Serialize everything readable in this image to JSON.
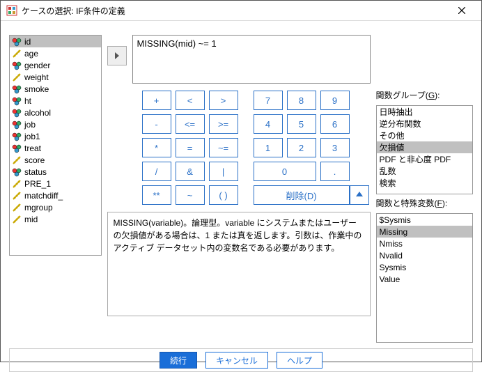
{
  "titlebar": {
    "title": "ケースの選択: IF条件の定義"
  },
  "variables": [
    {
      "name": "id",
      "type": "nominal",
      "selected": true
    },
    {
      "name": "age",
      "type": "scale",
      "selected": false
    },
    {
      "name": "gender",
      "type": "nominal",
      "selected": false
    },
    {
      "name": "weight",
      "type": "scale",
      "selected": false
    },
    {
      "name": "smoke",
      "type": "nominal",
      "selected": false
    },
    {
      "name": "ht",
      "type": "nominal",
      "selected": false
    },
    {
      "name": "alcohol",
      "type": "nominal",
      "selected": false
    },
    {
      "name": "job",
      "type": "nominal",
      "selected": false
    },
    {
      "name": "job1",
      "type": "nominal",
      "selected": false
    },
    {
      "name": "treat",
      "type": "nominal",
      "selected": false
    },
    {
      "name": "score",
      "type": "scale",
      "selected": false
    },
    {
      "name": "status",
      "type": "nominal",
      "selected": false
    },
    {
      "name": "PRE_1",
      "type": "scale",
      "selected": false
    },
    {
      "name": "matchdiff_",
      "type": "scale",
      "selected": false
    },
    {
      "name": "mgroup",
      "type": "scale",
      "selected": false
    },
    {
      "name": "mid",
      "type": "scale",
      "selected": false
    }
  ],
  "expression": "MISSING(mid) ~= 1",
  "keypad": {
    "rows": [
      [
        "+",
        "<",
        ">",
        "7",
        "8",
        "9"
      ],
      [
        "-",
        "<=",
        ">=",
        "4",
        "5",
        "6"
      ],
      [
        "*",
        "=",
        "~=",
        "1",
        "2",
        "3"
      ],
      [
        "/",
        "&",
        "|",
        "",
        "0",
        "."
      ],
      [
        "**",
        "~",
        "( )"
      ]
    ],
    "delete_label": "削除(D)"
  },
  "desc": "MISSING(variable)。論理型。variable にシステムまたはユーザーの欠損値がある場合は、1 または真を返します。引数は、作業中のアクティブ データセット内の変数名である必要があります。",
  "right": {
    "function_group_label": "関数グループ(",
    "function_group_underline": "G",
    "function_group_suffix": "):",
    "function_groups": [
      {
        "label": "日時抽出",
        "selected": false
      },
      {
        "label": "逆分布関数",
        "selected": false
      },
      {
        "label": "その他",
        "selected": false
      },
      {
        "label": "欠損値",
        "selected": true
      },
      {
        "label": "PDF と非心度 PDF",
        "selected": false
      },
      {
        "label": "乱数",
        "selected": false
      },
      {
        "label": "検索",
        "selected": false
      }
    ],
    "functions_label": "関数と特殊変数(",
    "functions_underline": "F",
    "functions_suffix": "):",
    "functions": [
      {
        "label": "$Sysmis",
        "selected": false
      },
      {
        "label": "Missing",
        "selected": true
      },
      {
        "label": "Nmiss",
        "selected": false
      },
      {
        "label": "Nvalid",
        "selected": false
      },
      {
        "label": "Sysmis",
        "selected": false
      },
      {
        "label": "Value",
        "selected": false
      }
    ]
  },
  "footer": {
    "continue": "続行",
    "cancel": "キャンセル",
    "help": "ヘルプ"
  }
}
